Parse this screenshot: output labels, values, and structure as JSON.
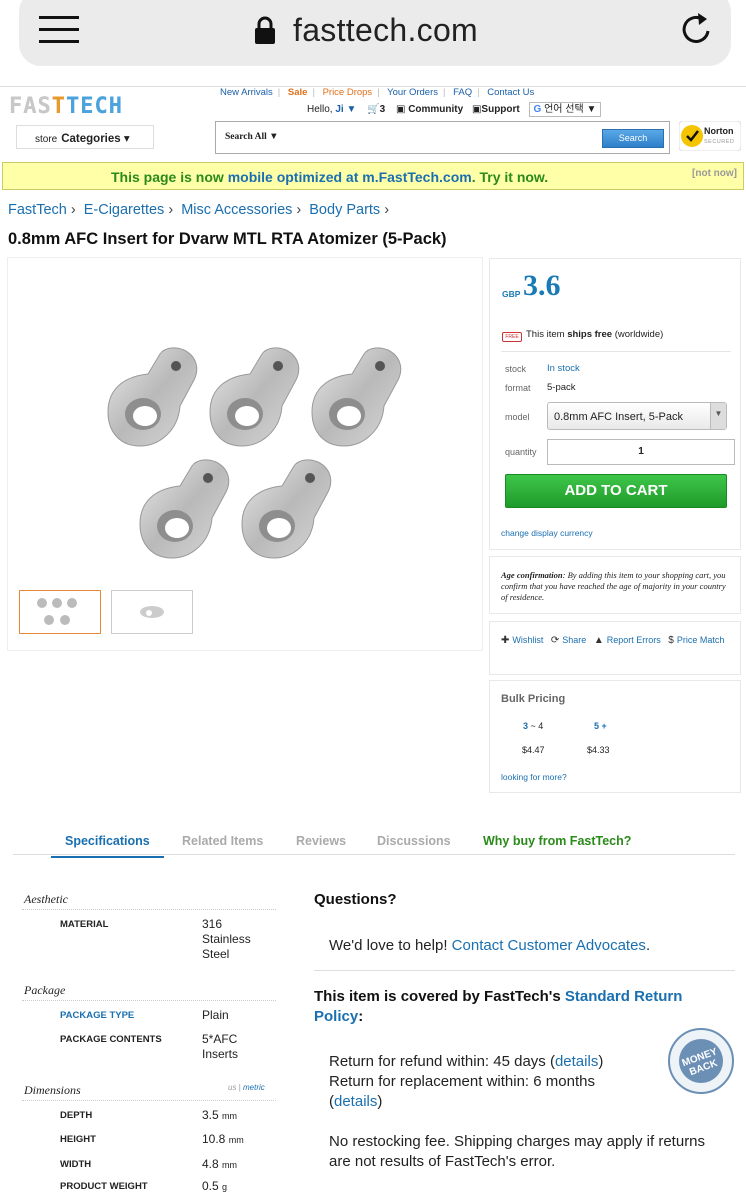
{
  "browser": {
    "url": "fasttech.com"
  },
  "header": {
    "logo": {
      "left": "FAS",
      "mid": "T",
      "right": "TECH"
    },
    "top_links": [
      "New Arrivals",
      "Sale",
      "Price Drops",
      "Your Orders",
      "FAQ",
      "Contact Us"
    ],
    "hello": "Hello,",
    "user": "Ji ▼",
    "cart_count": "3",
    "community": "Community",
    "support": "Support",
    "language": "언어 선택",
    "store_label": "store",
    "categories": "Categories ▾",
    "search_scope": "Search All ▼",
    "search_placeholder": "",
    "search_button": "Search",
    "norton": "Norton",
    "norton_sub": "SECURED"
  },
  "mobile_banner": {
    "pre": "This page is now ",
    "link": "mobile optimized at m.FastTech.com",
    "post": ". Try it now.",
    "dismiss": "[not now]"
  },
  "breadcrumb": [
    "FastTech",
    "E-Cigarettes",
    "Misc Accessories",
    "Body Parts"
  ],
  "breadcrumb_sep": "›",
  "product": {
    "title": "0.8mm AFC Insert for Dvarw MTL RTA Atomizer (5-Pack)",
    "currency": "GBP",
    "price": "3.6",
    "ships": {
      "pre": "This item ",
      "bold": "ships free",
      "post": " (worldwide)"
    },
    "free_icon": "FREE",
    "stock_label": "stock",
    "stock_value": "In stock",
    "format_label": "format",
    "format_value": "5-pack",
    "model_label": "model",
    "model_value": "0.8mm AFC Insert, 5-Pack",
    "quantity_label": "quantity",
    "quantity_value": "1",
    "add_to_cart": "ADD TO CART",
    "change_currency": "change display currency",
    "age_title": "Age confirmation",
    "age_text": ": By adding this item to your shopping cart, you confirm that you have reached the age of majority in your country of residence.",
    "actions": [
      "Wishlist",
      "Share",
      "Report Errors",
      "Price Match"
    ]
  },
  "bulk": {
    "title": "Bulk Pricing",
    "tiers": [
      {
        "qty_a": "3",
        "qty_b": " ~ 4",
        "price": "$4.47"
      },
      {
        "qty_a": "5",
        "qty_b": " +",
        "price": "$4.33"
      }
    ],
    "more": "looking for more?"
  },
  "tabs": [
    "Specifications",
    "Related Items",
    "Reviews",
    "Discussions",
    "Why buy from FastTech?"
  ],
  "specs": {
    "aesthetic": "Aesthetic",
    "material_key": "MATERIAL",
    "material_val": [
      "316",
      "Stainless",
      "Steel"
    ],
    "package": "Package",
    "package_type_key": "PACKAGE TYPE",
    "package_type_val": "Plain",
    "package_contents_key": "PACKAGE CONTENTS",
    "package_contents_val": [
      "5*AFC",
      "Inserts"
    ],
    "dimensions": "Dimensions",
    "unit_us": "us",
    "unit_metric": "metric",
    "depth_key": "DEPTH",
    "depth_val": "3.5",
    "depth_unit": "mm",
    "height_key": "HEIGHT",
    "height_val": "10.8",
    "height_unit": "mm",
    "width_key": "WIDTH",
    "width_val": "4.8",
    "width_unit": "mm",
    "weight_key": "PRODUCT WEIGHT",
    "weight_val": "0.5",
    "weight_unit": "g"
  },
  "questions": {
    "title": "Questions?",
    "help_pre": "We'd love to help! ",
    "help_link": "Contact Customer Advocates",
    "help_post": ".",
    "covered_pre": "This item is covered by FastTech's ",
    "covered_link": "Standard Return Policy",
    "covered_post": ":",
    "refund_pre": "Return for refund within: 45 days (",
    "details": "details",
    "close_paren": ")",
    "replace_pre": "Return for replacement within: 6 months",
    "open_paren": "(",
    "restock": "No restocking fee. Shipping charges may apply if returns are not results of FastTech's error.",
    "seal_top": "MONEY",
    "seal_bot": "BACK"
  }
}
